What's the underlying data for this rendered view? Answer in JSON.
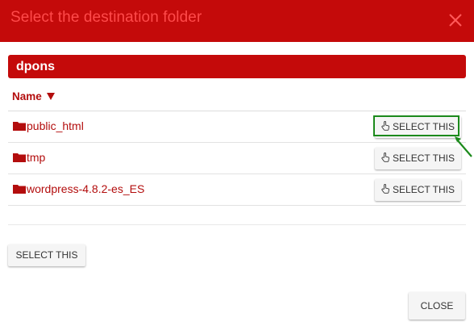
{
  "dialog": {
    "title": "Select the destination folder",
    "close_icon": "close-icon"
  },
  "path": {
    "current": "dpons"
  },
  "table": {
    "column_name": "Name",
    "sort_icon": "sort-descending-icon",
    "rows": [
      {
        "name": "public_html",
        "action": "SELECT THIS",
        "icon": "folder-icon"
      },
      {
        "name": "tmp",
        "action": "SELECT THIS",
        "icon": "folder-icon"
      },
      {
        "name": "wordpress-4.8.2-es_ES",
        "action": "SELECT THIS",
        "icon": "folder-icon"
      }
    ]
  },
  "footer": {
    "select_current": "SELECT THIS",
    "close": "CLOSE"
  },
  "colors": {
    "header_bg": "#c40a0a",
    "title_text": "#ff4a4a",
    "link_text": "#b30d0d",
    "highlight": "#1c8a1c"
  }
}
